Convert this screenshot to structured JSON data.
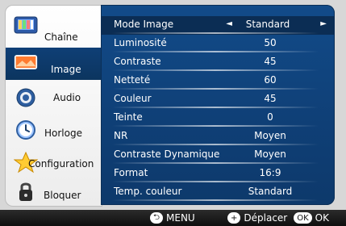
{
  "sidebar": {
    "items": [
      {
        "label": "Chaîne",
        "icon": "tv-channel-icon",
        "active": false
      },
      {
        "label": "Image",
        "icon": "picture-icon",
        "active": true
      },
      {
        "label": "Audio",
        "icon": "speaker-icon",
        "active": false
      },
      {
        "label": "Horloge",
        "icon": "clock-icon",
        "active": false
      },
      {
        "label": "Configuration",
        "icon": "star-icon",
        "active": false
      },
      {
        "label": "Bloquer",
        "icon": "lock-icon",
        "active": false
      }
    ]
  },
  "settings": {
    "rows": [
      {
        "name": "Mode Image",
        "value": "Standard",
        "selected": true
      },
      {
        "name": "Luminosité",
        "value": "50"
      },
      {
        "name": "Contraste",
        "value": "45"
      },
      {
        "name": "Netteté",
        "value": "60"
      },
      {
        "name": "Couleur",
        "value": "45"
      },
      {
        "name": "Teinte",
        "value": "0"
      },
      {
        "name": "NR",
        "value": "Moyen"
      },
      {
        "name": "Contraste Dynamique",
        "value": "Moyen"
      },
      {
        "name": "Format",
        "value": "16:9"
      },
      {
        "name": "Temp. couleur",
        "value": "Standard"
      }
    ],
    "arrow_left": "◄",
    "arrow_right": "►"
  },
  "footer": {
    "menu_icon_text": "⮌",
    "menu_label": "MENU",
    "move_icon_text": "+",
    "move_label": "Déplacer",
    "ok_badge": "OK",
    "ok_label": "OK"
  }
}
